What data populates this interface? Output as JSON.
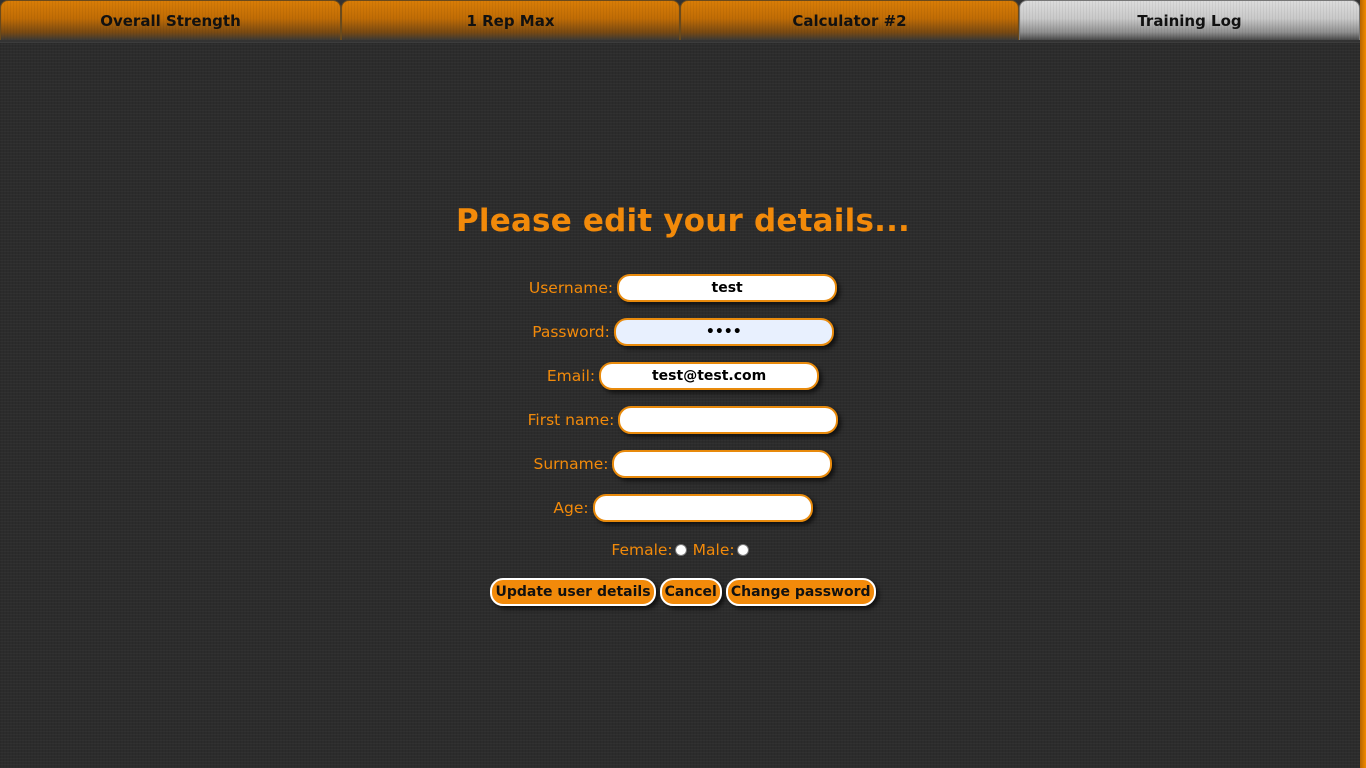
{
  "tabs": [
    {
      "label": "Overall Strength",
      "active": false
    },
    {
      "label": "1 Rep Max",
      "active": false
    },
    {
      "label": "Calculator #2",
      "active": false
    },
    {
      "label": "Training Log",
      "active": true
    }
  ],
  "form": {
    "title": "Please edit your details...",
    "fields": {
      "username": {
        "label": "Username:",
        "value": "test"
      },
      "password": {
        "label": "Password:",
        "value": "••••"
      },
      "email": {
        "label": "Email:",
        "value": "test@test.com"
      },
      "first_name": {
        "label": "First name:",
        "value": ""
      },
      "surname": {
        "label": "Surname:",
        "value": ""
      },
      "age": {
        "label": "Age:",
        "value": ""
      }
    },
    "gender": {
      "female_label": "Female:",
      "male_label": "Male:"
    },
    "buttons": {
      "update": "Update user details",
      "cancel": "Cancel",
      "change_password": "Change password"
    }
  },
  "colors": {
    "accent": "#f28a0a",
    "background": "#2c2c2c",
    "active_tab": "#c9c9c9"
  }
}
